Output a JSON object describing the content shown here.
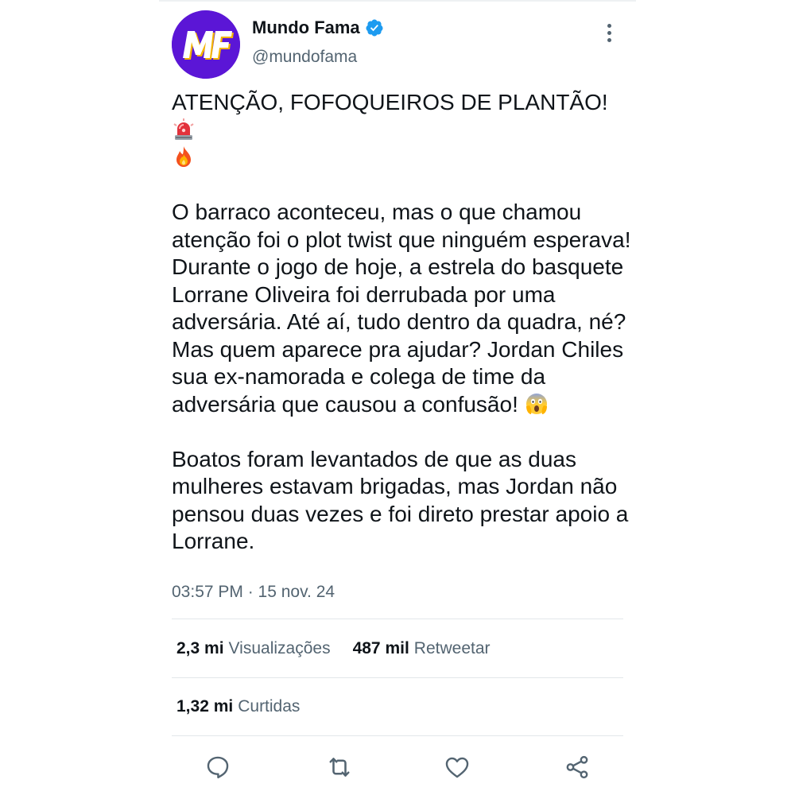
{
  "author": {
    "display_name": "Mundo Fama",
    "handle": "@mundofama",
    "avatar_initials": "MF",
    "avatar_color": "#5b16d6",
    "verified": true,
    "verified_color": "#1d9bf0"
  },
  "tweet": {
    "headline": "ATENÇÃO, FOFOQUEIROS DE PLANTÃO!",
    "headline_emojis": [
      "police-light-icon",
      "fire-icon"
    ],
    "paragraph_1": "O barraco aconteceu, mas o que chamou atenção foi o plot twist que ninguém esperava! Durante o jogo de hoje, a estrela do basquete Lorrane Oliveira foi derrubada por uma adversária. Até aí, tudo dentro da quadra, né? Mas quem aparece pra ajudar? Jordan Chiles sua ex-namorada e colega de time da adversária que causou a confusão!",
    "paragraph_1_emoji": "screaming-face-icon",
    "paragraph_2": "Boatos foram levantados de que as duas mulheres estavam brigadas, mas Jordan não pensou duas vezes e foi direto prestar apoio a Lorrane."
  },
  "meta": {
    "timestamp": "03:57 PM · 15 nov. 24"
  },
  "stats": {
    "views_value": "2,3 mi",
    "views_label": "Visualizações",
    "retweets_value": "487 mil",
    "retweets_label": "Retweetar",
    "likes_value": "1,32 mi",
    "likes_label": "Curtidas"
  },
  "actions": [
    "reply-icon",
    "retweet-icon",
    "like-icon",
    "share-icon"
  ],
  "colors": {
    "text": "#0f1419",
    "secondary": "#536471",
    "divider": "#e3e7ea"
  }
}
